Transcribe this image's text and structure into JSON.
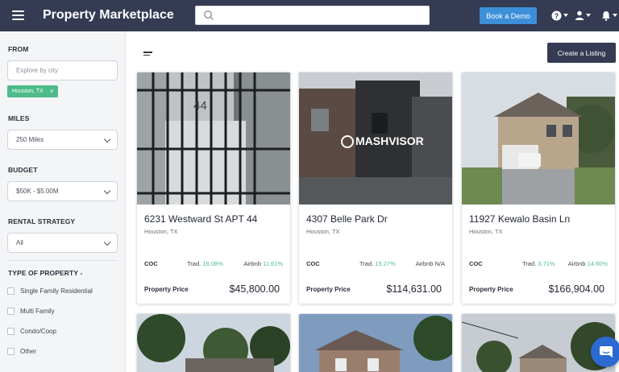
{
  "header": {
    "title": "Property Marketplace",
    "search_placeholder": "",
    "demo_button": "Book a Demo",
    "icons": [
      "menu-icon",
      "search-icon",
      "help-icon",
      "user-icon",
      "bell-icon"
    ]
  },
  "sidebar": {
    "from_label": "FROM",
    "city_placeholder": "Explore by city",
    "selected_city": "Houston, TX",
    "chip_remove": "×",
    "miles_label": "MILES",
    "miles_value": "250 Miles",
    "budget_label": "BUDGET",
    "budget_value": "$50K - $5.00M",
    "strategy_label": "RENTAL STRATEGY",
    "strategy_value": "All",
    "type_label": "TYPE OF PROPERTY -",
    "property_types": [
      "Single Family Residential",
      "Multi Family",
      "Condo/Coop",
      "Other"
    ]
  },
  "main": {
    "create_button": "Create a Listing",
    "listings": [
      {
        "address": "6231 Westward St APT 44",
        "city": "Houston, TX",
        "coc_label": "COC",
        "trad_label": "Trad.",
        "trad_value": "16.08%",
        "airbnb_label": "Airbnb",
        "airbnb_value": "11.61%",
        "price_label": "Property Price",
        "price": "$45,800.00"
      },
      {
        "address": "4307 Belle Park Dr",
        "city": "Houston, TX",
        "coc_label": "COC",
        "trad_label": "Trad.",
        "trad_value": "15.27%",
        "airbnb_label": "Airbnb",
        "airbnb_value": "N/A",
        "price_label": "Property Price",
        "price": "$114,631.00",
        "watermark": "MASHVISOR"
      },
      {
        "address": "11927 Kewalo Basin Ln",
        "city": "Houston, TX",
        "coc_label": "COC",
        "trad_label": "Trad.",
        "trad_value": "3.71%",
        "airbnb_label": "Airbnb",
        "airbnb_value": "14.60%",
        "price_label": "Property Price",
        "price": "$166,904.00"
      }
    ]
  },
  "colors": {
    "topbar": "#343b52",
    "accent_blue": "#3d8fd9",
    "accent_green": "#4dbb8a",
    "sidebar_bg": "#f4f5f7",
    "chat_button": "#2a6ad1"
  }
}
